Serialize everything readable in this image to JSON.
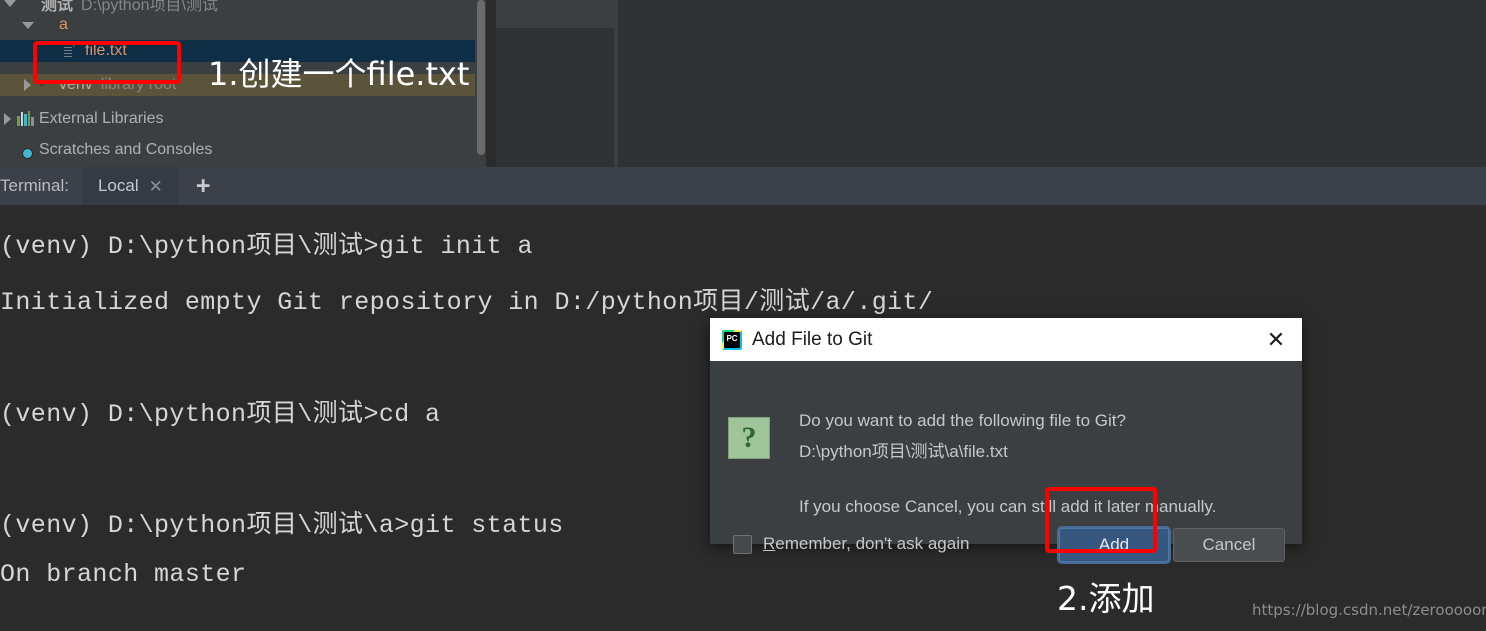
{
  "project_tree": {
    "rows": [
      {
        "label": "测试",
        "detail": "D:\\python项目\\测试",
        "icon": "module-icon",
        "state": "expanded"
      },
      {
        "label": "a",
        "detail": "",
        "icon": "folder-icon",
        "state": "expanded"
      },
      {
        "label": "file.txt",
        "detail": "",
        "icon": "text-file-icon",
        "state": "selected"
      },
      {
        "label": "venv",
        "detail": "library root",
        "icon": "folder-icon",
        "state": "collapsed"
      },
      {
        "label": "External Libraries",
        "detail": "",
        "icon": "libraries-icon",
        "state": "collapsed"
      },
      {
        "label": "Scratches and Consoles",
        "detail": "",
        "icon": "scratches-icon",
        "state": "leaf"
      }
    ]
  },
  "terminal": {
    "label": "Terminal:",
    "tab_label": "Local",
    "tab_close_glyph": "✕",
    "add_tab_glyph": "+",
    "lines": [
      "(venv) D:\\python项目\\测试>git init a",
      "Initialized empty Git repository in D:/python项目/测试/a/.git/",
      "(venv) D:\\python项目\\测试>cd a",
      "(venv) D:\\python项目\\测试\\a>git status",
      "On branch master"
    ]
  },
  "dialog": {
    "title": "Add File to Git",
    "app_icon": "pycharm-icon",
    "close_glyph": "✕",
    "question_glyph": "?",
    "message_line_1": "Do you want to add the following file to Git?",
    "message_line_2": "D:\\python项目\\测试\\a\\file.txt",
    "message_line_3": "If you choose Cancel, you can still add it later manually.",
    "checkbox_label_prefix": "",
    "checkbox_label_mnemonic": "R",
    "checkbox_label_rest": "emember, don't ask again",
    "checkbox_checked": false,
    "add_label_mnemonic": "A",
    "add_label_rest": "dd",
    "cancel_label": "Cancel"
  },
  "annotations": {
    "step_1": "1.创建一个file.txt",
    "step_2": "2.添加",
    "highlight_color": "#ff0000"
  },
  "watermark": "https://blog.csdn.net/zerooooorez"
}
